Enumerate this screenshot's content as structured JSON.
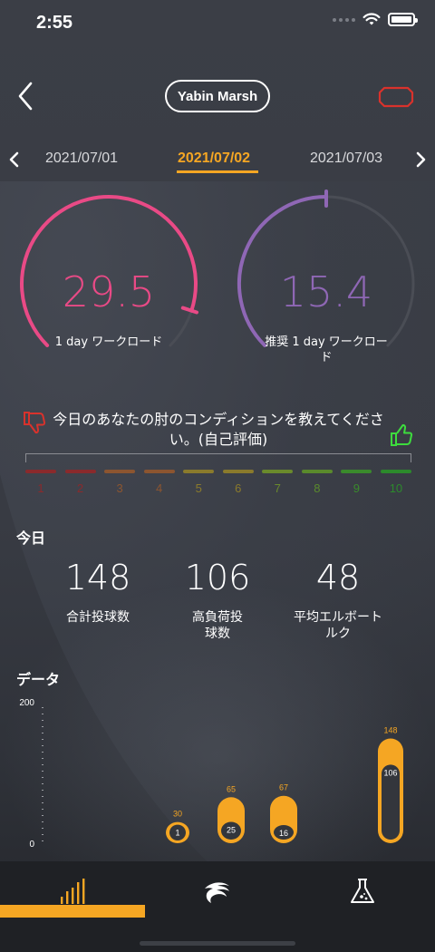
{
  "status_bar": {
    "time": "2:55"
  },
  "header": {
    "player_name": "Yabin Marsh"
  },
  "dates": {
    "prev": "2021/07/01",
    "current": "2021/07/02",
    "next": "2021/07/03"
  },
  "gauges": {
    "workload": {
      "value": "29.5",
      "label": "1 day ワークロード",
      "fraction": 0.9,
      "color": "#e94a86"
    },
    "recommended": {
      "value": "15.4",
      "label": "推奨 1 day ワークロード",
      "fraction": 0.5,
      "color": "#8f67b5"
    }
  },
  "condition": {
    "question": "今日のあなたの肘のコンディションを教えてください。(自己評価)",
    "scale": [
      {
        "label": "1",
        "color": "#8a2a2c"
      },
      {
        "label": "2",
        "color": "#8a2a2c"
      },
      {
        "label": "3",
        "color": "#8c5530"
      },
      {
        "label": "4",
        "color": "#8c5530"
      },
      {
        "label": "5",
        "color": "#8a7a2c"
      },
      {
        "label": "6",
        "color": "#8a7a2c"
      },
      {
        "label": "7",
        "color": "#6a8a2c"
      },
      {
        "label": "8",
        "color": "#5a8a2c"
      },
      {
        "label": "9",
        "color": "#3a8a2c"
      },
      {
        "label": "10",
        "color": "#2c8a2c"
      }
    ]
  },
  "today": {
    "title": "今日",
    "stats": [
      {
        "value": "148",
        "label": "合計投球数"
      },
      {
        "value": "106",
        "label": "高負荷投球数"
      },
      {
        "value": "48",
        "label": "平均エルボートルク"
      }
    ]
  },
  "data_section": {
    "title": "データ"
  },
  "chart_data": {
    "type": "bar",
    "ylim": [
      0,
      200
    ],
    "y_ticks": [
      "200",
      "0"
    ],
    "color": "#f5a623",
    "series": [
      {
        "values": [
          30,
          65,
          67,
          148
        ]
      },
      {
        "values": [
          1,
          25,
          16,
          106
        ]
      }
    ],
    "total_labels": [
      "30",
      "65",
      "67",
      "148"
    ],
    "high_labels": [
      "1",
      "25",
      "16",
      "106"
    ]
  },
  "tabs": [
    {
      "icon": "bar-chart-icon",
      "active": true
    },
    {
      "icon": "arm-swing-icon",
      "active": false
    },
    {
      "icon": "flask-icon",
      "active": false
    }
  ]
}
